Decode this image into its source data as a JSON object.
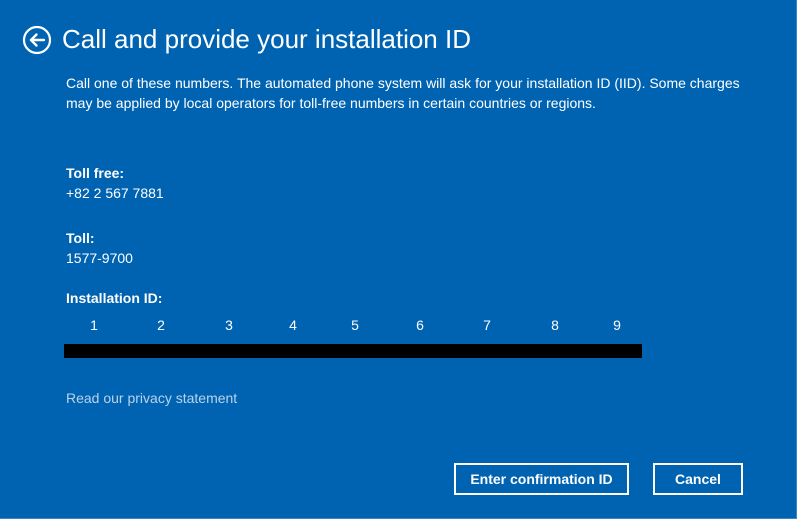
{
  "header": {
    "title": "Call and provide your installation ID",
    "back_icon": "back-arrow-circle-icon"
  },
  "description": "Call one of these numbers. The automated phone system will ask for your installation ID (IID). Some charges may be applied by local operators for toll-free numbers in certain countries or regions.",
  "contacts": {
    "toll_free_label": "Toll free:",
    "toll_free_number": "+82 2 567 7881",
    "toll_label": "Toll:",
    "toll_number": "1577-9700"
  },
  "installation_id": {
    "label": "Installation ID:",
    "group_numbers": [
      "1",
      "2",
      "3",
      "4",
      "5",
      "6",
      "7",
      "8",
      "9"
    ],
    "value_redacted": true
  },
  "links": {
    "privacy": "Read our privacy statement"
  },
  "buttons": {
    "enter_confirmation": "Enter confirmation ID",
    "cancel": "Cancel"
  },
  "colors": {
    "background": "#0063b1",
    "text": "#ffffff",
    "link": "#b7d3ec",
    "redaction": "#000000"
  }
}
